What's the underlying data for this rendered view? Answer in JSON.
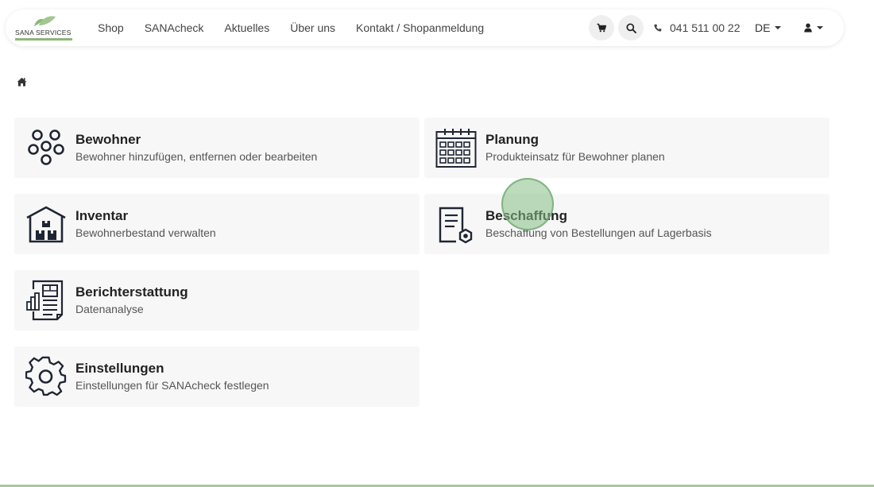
{
  "logo": {
    "text": "SANA SERVICES"
  },
  "nav": {
    "links": [
      "Shop",
      "SANAcheck",
      "Aktuelles",
      "Über uns",
      "Kontakt / Shopanmeldung"
    ],
    "phone": "041 511 00 22",
    "language": "DE"
  },
  "cards": [
    {
      "title": "Bewohner",
      "subtitle": "Bewohner hinzufügen, entfernen oder bearbeiten",
      "icon": "residents-icon"
    },
    {
      "title": "Planung",
      "subtitle": "Produkteinsatz für Bewohner planen",
      "icon": "calendar-icon"
    },
    {
      "title": "Inventar",
      "subtitle": "Bewohnerbestand verwalten",
      "icon": "warehouse-icon"
    },
    {
      "title": "Beschaffung",
      "subtitle": "Beschaffung von Bestellungen auf Lagerbasis",
      "icon": "procurement-icon"
    },
    {
      "title": "Berichterstattung",
      "subtitle": "Datenanalyse",
      "icon": "report-icon"
    },
    {
      "title": "Einstellungen",
      "subtitle": "Einstellungen für SANAcheck festlegen",
      "icon": "gear-icon"
    }
  ],
  "colors": {
    "brand_green": "#8bb878",
    "card_bg": "#f7f7f7",
    "icon_dark": "#1f2533"
  }
}
